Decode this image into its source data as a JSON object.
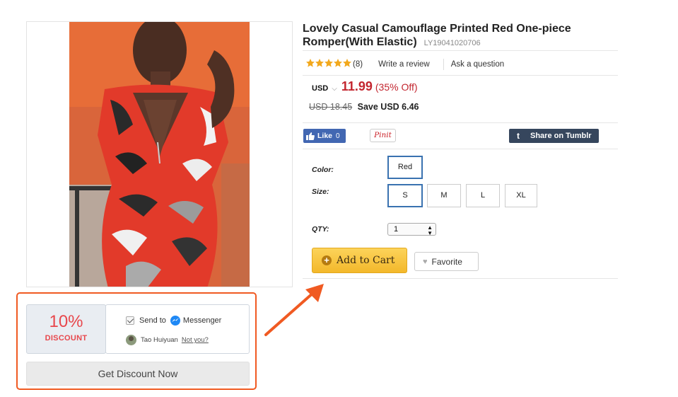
{
  "product": {
    "title": "Lovely Casual Camouflage Printed Red One-piece Romper(With Elastic)",
    "sku": "LY19041020706",
    "rating": {
      "stars": 5,
      "count_label": "(8)"
    },
    "write_review": "Write a review",
    "ask_question": "Ask a question",
    "price": {
      "currency": "USD",
      "current": "11.99",
      "off": "(35% Off)",
      "old": "USD 18.45",
      "save": "Save USD 6.46"
    },
    "social": {
      "like_label": "Like",
      "like_count": "0",
      "pin_label": "Pinit",
      "tumblr_label": "Share on Tumblr"
    },
    "options": {
      "color_label": "Color:",
      "colors": [
        "Red"
      ],
      "selected_color": "Red",
      "size_label": "Size:",
      "sizes": [
        "S",
        "M",
        "L",
        "XL"
      ],
      "selected_size": "S",
      "qty_label": "QTY:",
      "qty_value": "1"
    },
    "add_to_cart": "Add to Cart",
    "favorite": "Favorite"
  },
  "promo": {
    "discount_percent": "10%",
    "discount_word": "DISCOUNT",
    "send_to": "Send to",
    "messenger": "Messenger",
    "user_name": "Tao Huiyuan",
    "not_you": "Not you?",
    "cta": "Get Discount Now"
  },
  "colors": {
    "price_red": "#c3262f",
    "highlight_orange": "#f05a22",
    "facebook_blue": "#4267b2",
    "tumblr_navy": "#36465d",
    "cart_yellow": "#f3b82b",
    "selected_border": "#3a72b0"
  }
}
